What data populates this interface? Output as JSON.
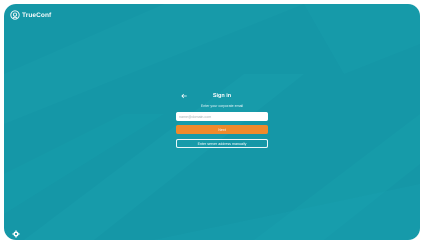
{
  "app": {
    "logo_text": "TrueConf",
    "logo_icon": "trueconf-logo-icon"
  },
  "signin": {
    "back_icon": "arrow-left-icon",
    "title": "Sign in",
    "subtitle": "Enter your corporate email",
    "email_placeholder": "name@domain.com",
    "email_value": "",
    "next_label": "Next",
    "manual_label": "Enter server address manually"
  },
  "footer": {
    "settings_icon": "gear-icon"
  },
  "colors": {
    "background": "#1597a7",
    "accent": "#f08a2c",
    "text": "#ffffff"
  }
}
